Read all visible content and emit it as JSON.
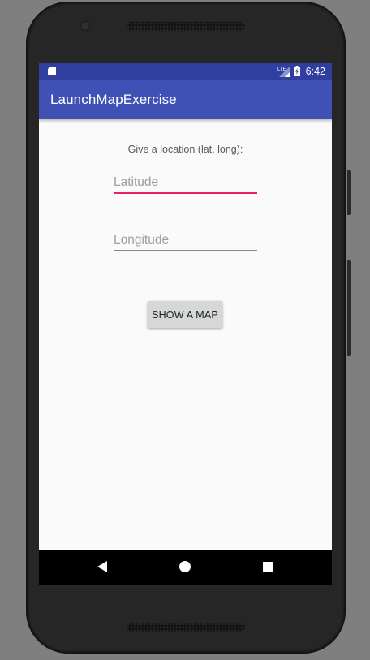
{
  "status_bar": {
    "time": "6:42",
    "network_label": "LTE",
    "icons": [
      "sd-card-icon",
      "lte-signal-icon",
      "battery-charging-icon"
    ],
    "color": "#303f9f"
  },
  "app_bar": {
    "title": "LaunchMapExercise",
    "color": "#3f51b5"
  },
  "form": {
    "prompt": "Give a location (lat, long):",
    "latitude": {
      "value": "",
      "placeholder": "Latitude",
      "focused": true
    },
    "longitude": {
      "value": "",
      "placeholder": "Longitude",
      "focused": false
    },
    "submit_label": "SHOW A MAP",
    "accent_color": "#e91e63"
  },
  "nav_bar": {
    "buttons": [
      "back-icon",
      "home-icon",
      "recents-icon"
    ]
  }
}
